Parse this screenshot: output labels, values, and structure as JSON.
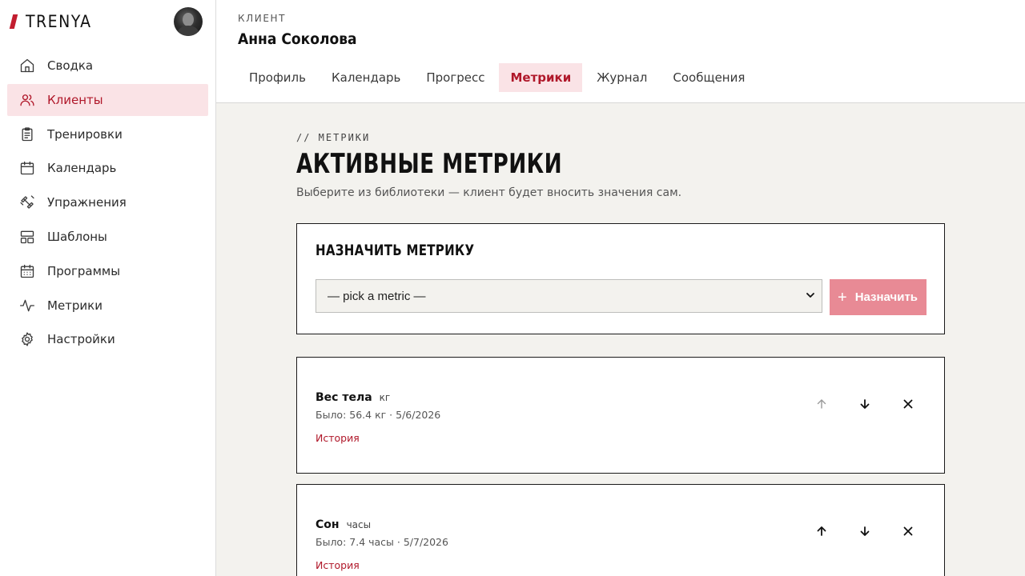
{
  "brand": {
    "name": "TRENYA"
  },
  "sidebar": {
    "items": [
      {
        "label": "Сводка",
        "icon": "home-icon",
        "active": false
      },
      {
        "label": "Клиенты",
        "icon": "users-icon",
        "active": true
      },
      {
        "label": "Тренировки",
        "icon": "clipboard-icon",
        "active": false
      },
      {
        "label": "Календарь",
        "icon": "calendar-icon",
        "active": false
      },
      {
        "label": "Упражнения",
        "icon": "dumbbell-icon",
        "active": false
      },
      {
        "label": "Шаблоны",
        "icon": "layout-icon",
        "active": false
      },
      {
        "label": "Программы",
        "icon": "calendar-grid-icon",
        "active": false
      },
      {
        "label": "Метрики",
        "icon": "activity-icon",
        "active": false
      },
      {
        "label": "Настройки",
        "icon": "gear-icon",
        "active": false
      }
    ]
  },
  "header": {
    "client_label": "КЛИЕНТ",
    "client_name": "Анна Соколова",
    "tabs": [
      {
        "label": "Профиль",
        "active": false
      },
      {
        "label": "Календарь",
        "active": false
      },
      {
        "label": "Прогресс",
        "active": false
      },
      {
        "label": "Метрики",
        "active": true
      },
      {
        "label": "Журнал",
        "active": false
      },
      {
        "label": "Сообщения",
        "active": false
      }
    ]
  },
  "main": {
    "eyebrow": "// МЕТРИКИ",
    "title": "АКТИВНЫЕ МЕТРИКИ",
    "subtitle": "Выберите из библиотеки — клиент будет вносить значения сам.",
    "assign": {
      "title": "НАЗНАЧИТЬ МЕТРИКУ",
      "select_value": "— pick a metric —",
      "button_label": "Назначить",
      "button_icon": "plus-icon"
    },
    "metrics": [
      {
        "name": "Вес тела",
        "unit": "кг",
        "previous": "Было: 56.4 кг · 5/6/2026",
        "history_label": "История",
        "move_up_disabled": true
      },
      {
        "name": "Сон",
        "unit": "часы",
        "previous": "Было: 7.4 часы · 5/7/2026",
        "history_label": "История",
        "move_up_disabled": false
      }
    ]
  },
  "colors": {
    "accent": "#b0182a",
    "accent_light": "#fae3e6",
    "button_disabled": "#e88a95",
    "background": "#f3f2ee"
  }
}
